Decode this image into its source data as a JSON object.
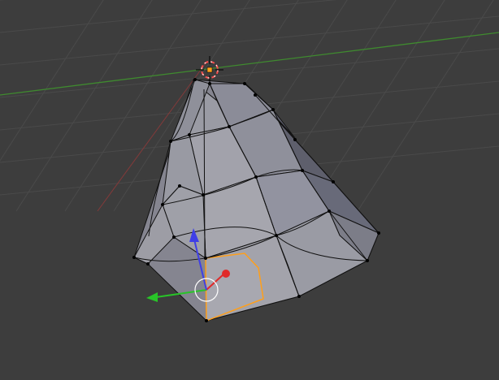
{
  "viewport": {
    "background": "#3d3d3d",
    "grid_color": "#4a4a4a",
    "x_axis_color": "#8a3a3a",
    "y_axis_color": "#3f8a2f"
  },
  "mesh": {
    "object": "cone",
    "mode": "edit",
    "face_light": "#9c9ca4",
    "face_mid": "#858590",
    "face_dark": "#5e5f6c",
    "edge_color": "#111111",
    "vertex_color": "#000000",
    "selection_color": "#ff9f1a"
  },
  "gizmo": {
    "x_color": "#e02a2a",
    "y_color": "#28c428",
    "z_color": "#3f3fe6"
  },
  "cursor_3d": {
    "ring_colors": [
      "#ff4d4d",
      "#ffffff"
    ]
  }
}
